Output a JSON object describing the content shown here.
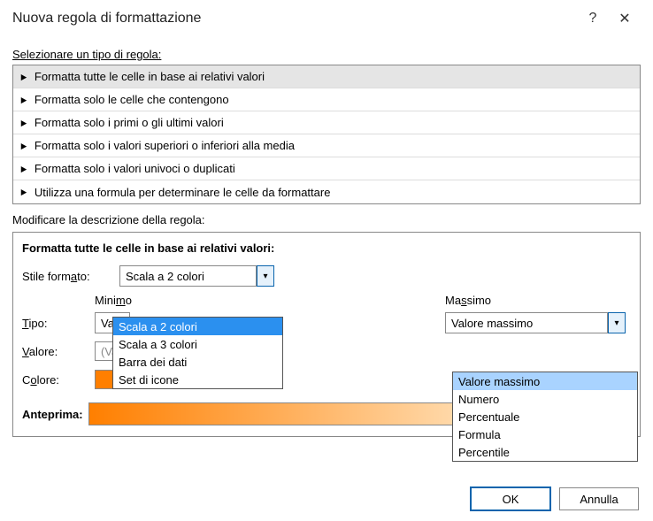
{
  "title": "Nuova regola di formattazione",
  "section_select": "Selezionare un tipo di regola:",
  "section_edit": "Modificare la descrizione della regola:",
  "rules": [
    "Formatta tutte le celle in base ai relativi valori",
    "Formatta solo le celle che contengono",
    "Formatta solo i primi o gli ultimi valori",
    "Formatta solo i valori superiori o inferiori alla media",
    "Formatta solo i valori univoci o duplicati",
    "Utilizza una formula per determinare le celle da formattare"
  ],
  "desc_title": "Formatta tutte le celle in base ai relativi valori:",
  "style_label_pre": "Stile form",
  "style_label_u": "a",
  "style_label_post": "to:",
  "style_value": "Scala a 2 colori",
  "style_options": [
    "Scala a 2 colori",
    "Scala a 3 colori",
    "Barra dei dati",
    "Set di icone"
  ],
  "min_head_pre": "Mini",
  "min_head_u": "m",
  "min_head_post": "o",
  "max_head_pre": "Ma",
  "max_head_u": "s",
  "max_head_post": "simo",
  "type_label_u": "T",
  "type_label_post": "ipo:",
  "type_min_value": "Valore",
  "type_max_value": "Valore massimo",
  "max_options": [
    "Valore massimo",
    "Numero",
    "Percentuale",
    "Formula",
    "Percentile"
  ],
  "value_label_u": "V",
  "value_label_post": "alore:",
  "value_min_placeholder": "(Valore minimo)",
  "color_label_pre": "C",
  "color_label_u": "o",
  "color_label_post": "lore:",
  "preview_label": "Anteprima:",
  "ok": "OK",
  "cancel": "Annulla"
}
